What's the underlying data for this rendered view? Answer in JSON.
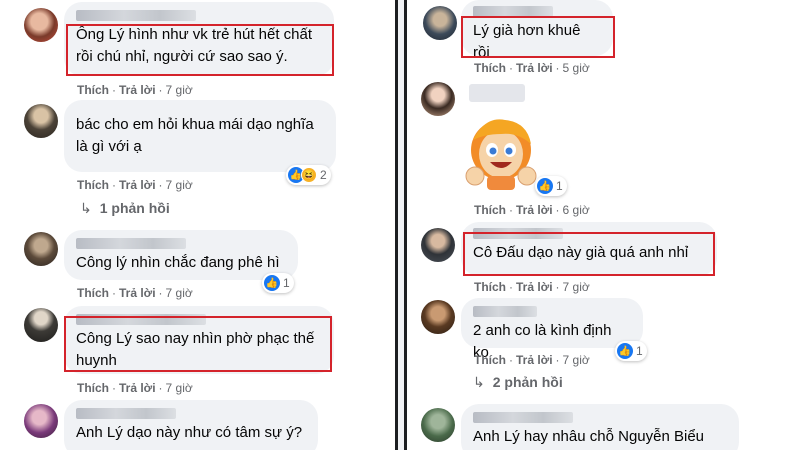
{
  "actions": {
    "like": "Thích",
    "reply": "Trả lời",
    "dot": "·"
  },
  "left": [
    {
      "text": "Ông Lý hình như vk trẻ hút hết chất rồi chú nhỉ, người cứ sao sao ý.",
      "time": "7 giờ"
    },
    {
      "text": "bác cho em hỏi khua mái dạo nghĩa là gì với ạ",
      "time": "7 giờ",
      "reaction_count": "2",
      "replies": "1 phản hồi"
    },
    {
      "text": "Công lý nhìn chắc đang phê hì",
      "time": "7 giờ",
      "reaction_count": "1"
    },
    {
      "text": "Công Lý sao nay nhìn phờ phạc thế huynh",
      "time": "7 giờ"
    },
    {
      "text": "Anh Lý dạo này như có tâm sự ý?"
    }
  ],
  "right": [
    {
      "text": "Lý già hơn khuê rồi",
      "time": "5 giờ"
    },
    {
      "time": "6 giờ",
      "reaction_count": "1"
    },
    {
      "text": "Cô Đấu dạo này già quá anh nhỉ",
      "time": "7 giờ"
    },
    {
      "text": "2 anh co là kình định ko",
      "time": "7 giờ",
      "reaction_count": "1",
      "replies": "2 phản hồi"
    },
    {
      "text": "Anh Lý hay nhâu chỗ Nguyễn Biểu"
    }
  ],
  "colors": {
    "bubble": "#f0f2f5",
    "highlight": "#d4232b",
    "like": "#1877f2",
    "meta": "#65676b"
  }
}
